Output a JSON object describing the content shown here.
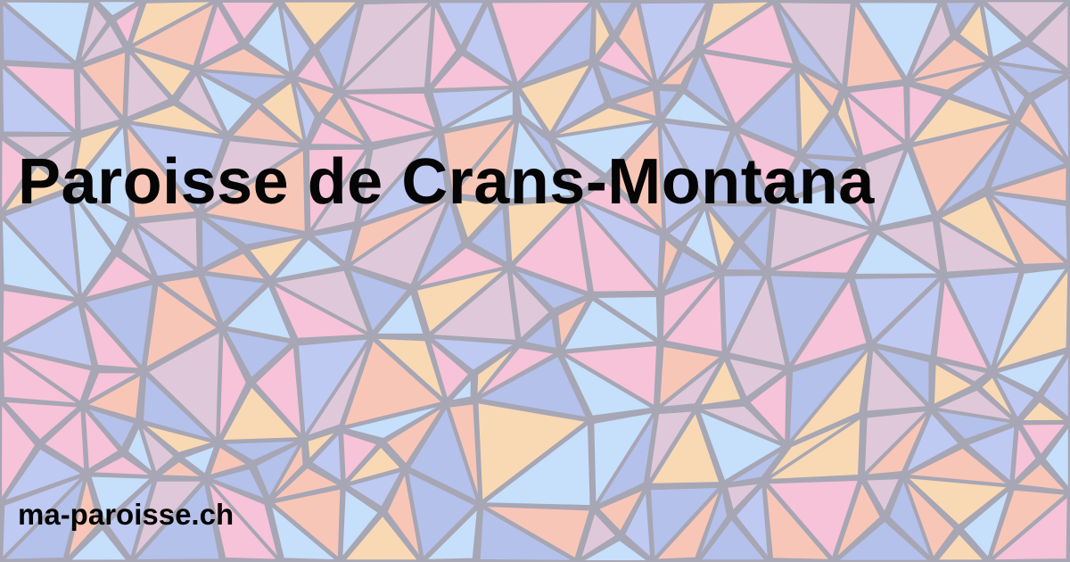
{
  "page": {
    "title": "Paroisse de Crans-Montana",
    "site": "ma-paroisse.ch"
  },
  "background": {
    "pattern": "stained-glass-mosaic",
    "lead_color": "#8f8d9f",
    "colors": [
      "#aebcf0",
      "#f7b7a3",
      "#f7cf9f",
      "#f4b2cd",
      "#b7d6fa",
      "#d7b9cf",
      "#9fb0e4"
    ]
  }
}
